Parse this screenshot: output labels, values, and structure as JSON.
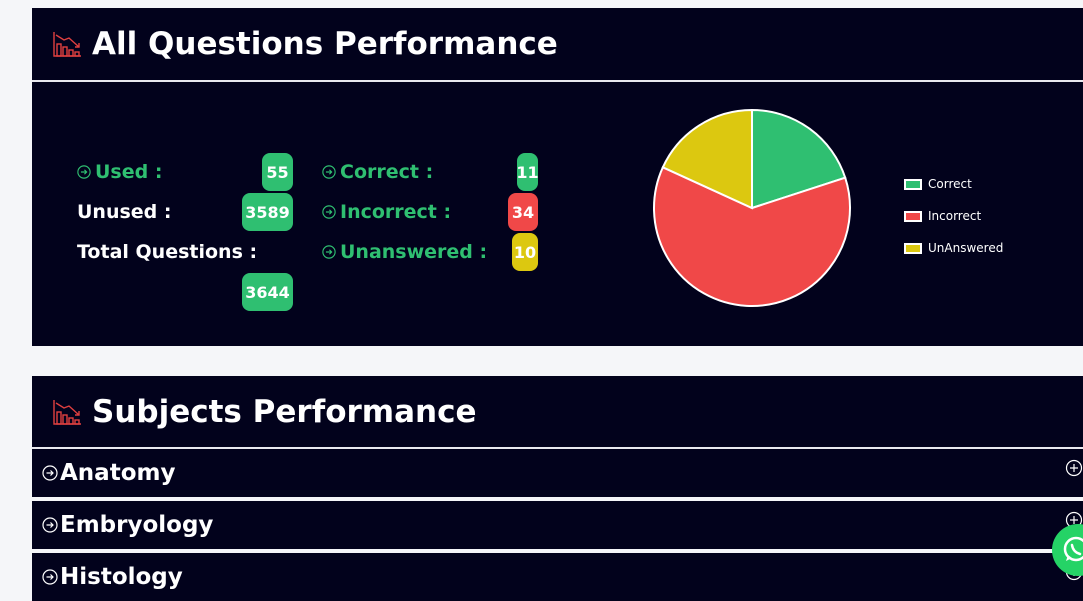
{
  "performance": {
    "title": "All Questions Performance",
    "icon": "chart-decline-icon",
    "stats": {
      "used_label": "Used :",
      "used_value": "55",
      "unused_label": "Unused :",
      "unused_value": "3589",
      "total_label": "Total Questions :",
      "total_value": "3644",
      "correct_label": "Correct :",
      "correct_value": "11",
      "incorrect_label": "Incorrect :",
      "incorrect_value": "34",
      "unanswered_label": "Unanswered :",
      "unanswered_value": "10"
    },
    "chart_data": {
      "type": "pie",
      "categories": [
        "Correct",
        "Incorrect",
        "UnAnswered"
      ],
      "values": [
        11,
        34,
        10
      ],
      "colors": [
        "#2fbf71",
        "#f04848",
        "#dcc810"
      ],
      "legend_placement": "right"
    }
  },
  "subjects": {
    "title": "Subjects Performance",
    "icon": "chart-decline-icon",
    "items": [
      {
        "name": "Anatomy"
      },
      {
        "name": "Embryology"
      },
      {
        "name": "Histology"
      }
    ]
  },
  "colors": {
    "panel_bg": "#02021c",
    "green": "#2fbf71",
    "red": "#f04848",
    "yellow": "#dcc810",
    "whatsapp": "#25d366"
  }
}
